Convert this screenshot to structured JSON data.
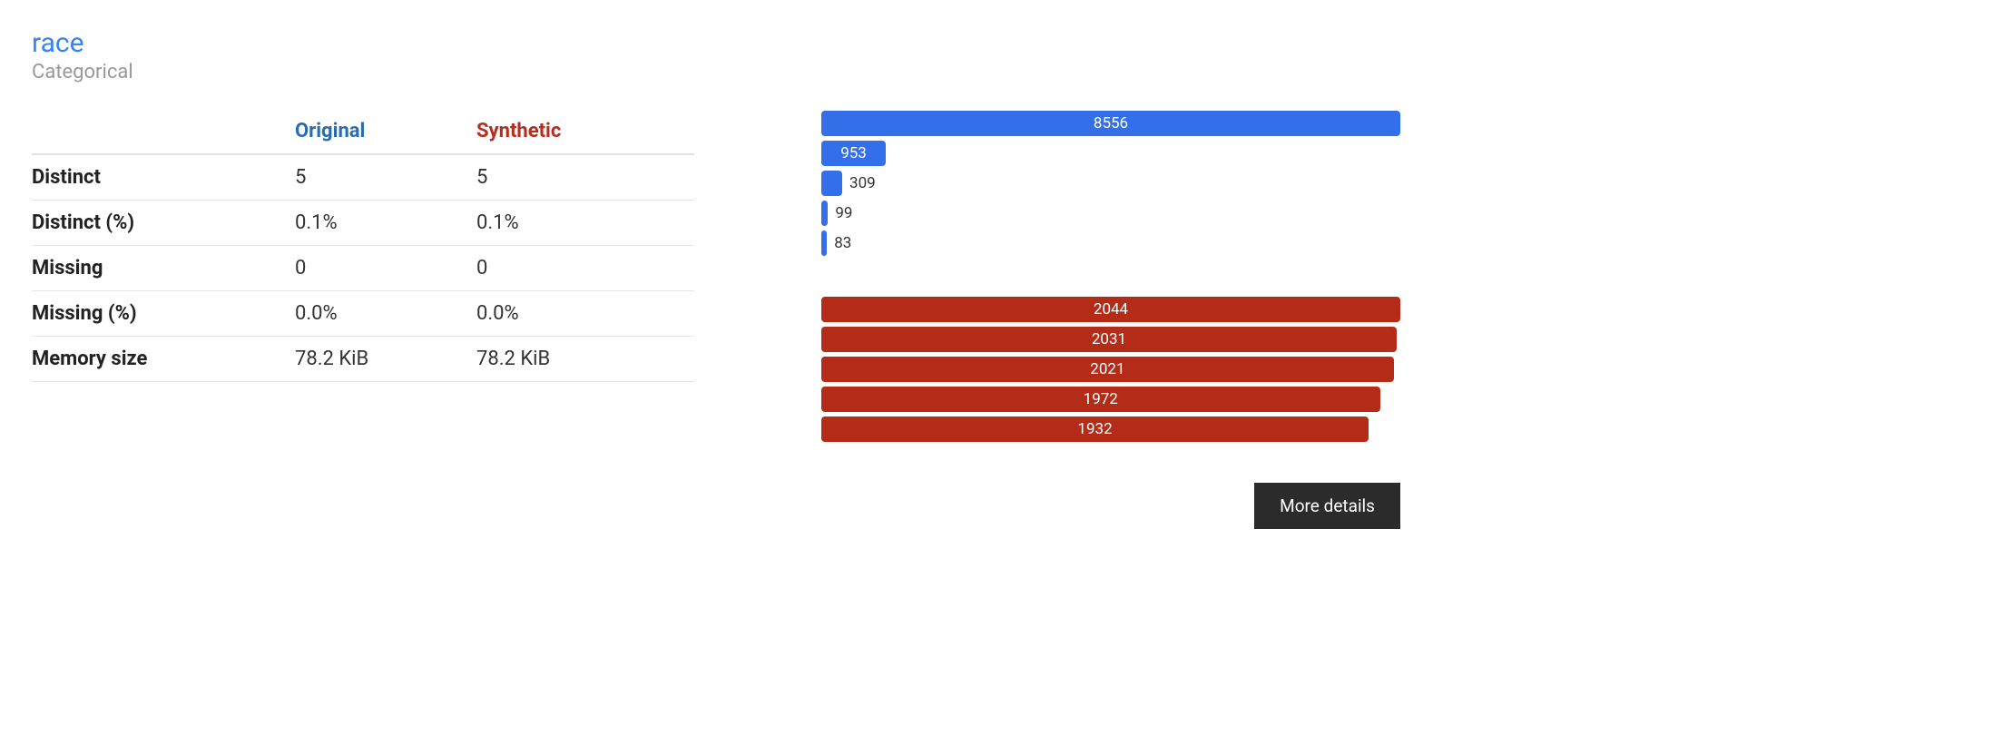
{
  "variable": {
    "name": "race",
    "type": "Categorical"
  },
  "columns": {
    "original": "Original",
    "synthetic": "Synthetic"
  },
  "stats": [
    {
      "label": "Distinct",
      "original": "5",
      "synthetic": "5"
    },
    {
      "label": "Distinct (%)",
      "original": "0.1%",
      "synthetic": "0.1%"
    },
    {
      "label": "Missing",
      "original": "0",
      "synthetic": "0"
    },
    {
      "label": "Missing (%)",
      "original": "0.0%",
      "synthetic": "0.0%"
    },
    {
      "label": "Memory size",
      "original": "78.2 KiB",
      "synthetic": "78.2 KiB"
    }
  ],
  "chart_data": {
    "type": "bar",
    "original": {
      "values": [
        8556,
        953,
        309,
        99,
        83
      ],
      "max": 8556
    },
    "synthetic": {
      "values": [
        2044,
        2031,
        2021,
        1972,
        1932
      ],
      "max": 2044
    }
  },
  "buttons": {
    "more_details": "More details"
  }
}
